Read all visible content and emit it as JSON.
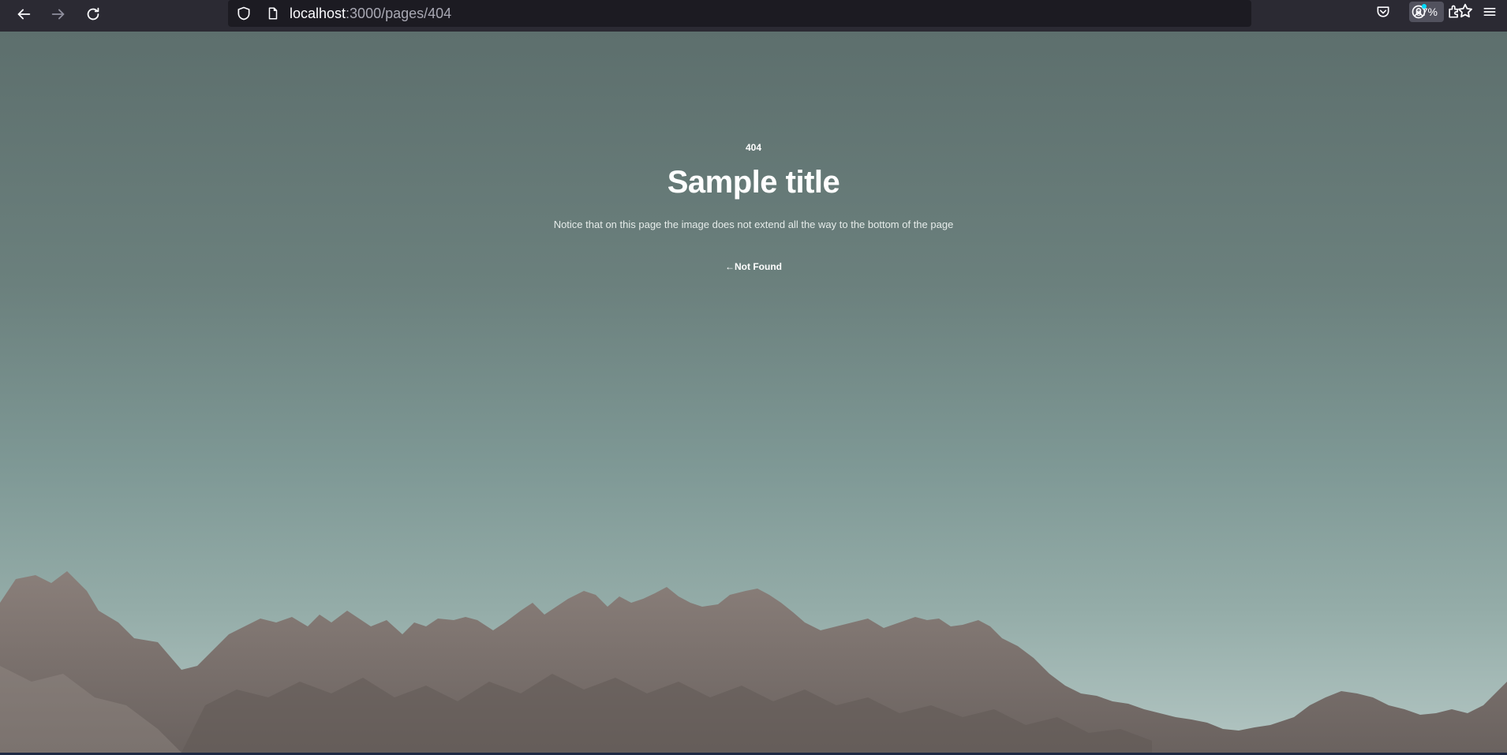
{
  "browser": {
    "url_host": "localhost",
    "url_path": ":3000/pages/404",
    "zoom": "67%",
    "icons": {
      "back": "back-arrow-icon",
      "forward": "forward-arrow-icon",
      "reload": "reload-icon",
      "shield": "shield-icon",
      "page": "page-icon",
      "bookmark": "star-icon",
      "pocket": "pocket-icon",
      "account": "account-icon",
      "extensions": "extensions-icon",
      "menu": "hamburger-menu-icon"
    }
  },
  "page": {
    "code": "404",
    "title": "Sample title",
    "description": "Notice that on this page the image does not extend all the way to the bottom of the page",
    "link_label": "←Not Found"
  },
  "colors": {
    "toolbar_bg": "#2b2a33",
    "urlbar_bg": "#1c1b22",
    "sky_top": "#5d6f6d",
    "sky_bottom": "#b3c6c3",
    "mountain": "#7f7571"
  }
}
